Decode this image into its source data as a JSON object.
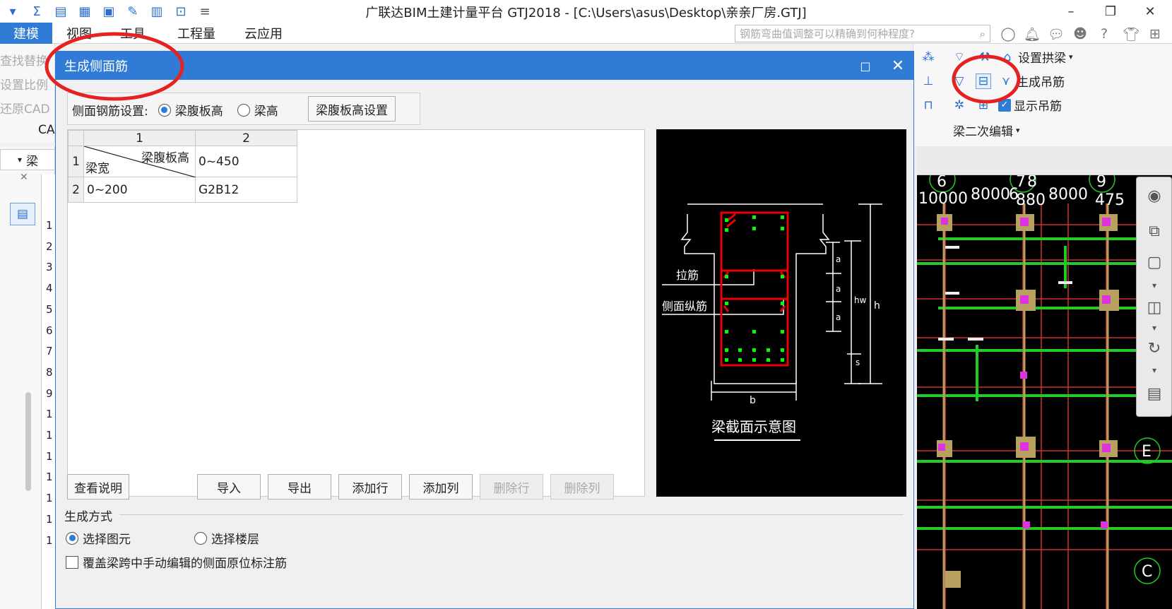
{
  "app": {
    "title": "广联达BIM土建计量平台 GTJ2018 - [C:\\Users\\asus\\Desktop\\亲亲厂房.GTJ]"
  },
  "menu": [
    "建模",
    "视图",
    "工具",
    "工程量",
    "云应用"
  ],
  "search": {
    "placeholder": "钢筋弯曲值调整可以精确到何种程度?"
  },
  "ribbon_left": [
    "查找替换",
    "设置比例",
    "还原CAD",
    "CA"
  ],
  "left_combo": {
    "value": "梁"
  },
  "left_rows": [
    "1",
    "2",
    "3",
    "4",
    "5",
    "6",
    "7",
    "8",
    "9",
    "1",
    "1",
    "1",
    "1",
    "1",
    "1",
    "1"
  ],
  "ribbon_right": {
    "row1": "设置拱梁",
    "row2": "生成吊筋",
    "row3": "显示吊筋",
    "group": "梁二次编辑"
  },
  "canvas": {
    "axis_nums": [
      "6",
      "7",
      "8",
      "9"
    ],
    "dims": [
      "10000",
      "8000",
      "6",
      "880",
      "8000",
      "475"
    ],
    "letters": [
      "E",
      "C"
    ]
  },
  "dialog": {
    "title": "生成侧面筋",
    "setting_label": "侧面钢筋设置:",
    "options": [
      {
        "label": "梁腹板高",
        "checked": true
      },
      {
        "label": "梁高",
        "checked": false
      }
    ],
    "setting_button": "梁腹板高设置",
    "table": {
      "col_headers": [
        "1",
        "2"
      ],
      "row_headers": [
        "1",
        "2"
      ],
      "corner_top": "梁腹板高",
      "corner_bottom": "梁宽",
      "r1c2": "0~450",
      "r2c1": "0~200",
      "r2c2": "G2B12"
    },
    "preview": {
      "tie": "拉筋",
      "side": "侧面纵筋",
      "a": "a",
      "hw": "hw",
      "h": "h",
      "s": "s",
      "b": "b",
      "caption": "梁截面示意图"
    },
    "buttons": {
      "help": "查看说明",
      "import": "导入",
      "export": "导出",
      "add_row": "添加行",
      "add_col": "添加列",
      "del_row": "删除行",
      "del_col": "删除列"
    },
    "gen_title": "生成方式",
    "gen_options": [
      {
        "label": "选择图元",
        "checked": true
      },
      {
        "label": "选择楼层",
        "checked": false
      }
    ],
    "override": "覆盖梁跨中手动编辑的侧面原位标注筋"
  }
}
